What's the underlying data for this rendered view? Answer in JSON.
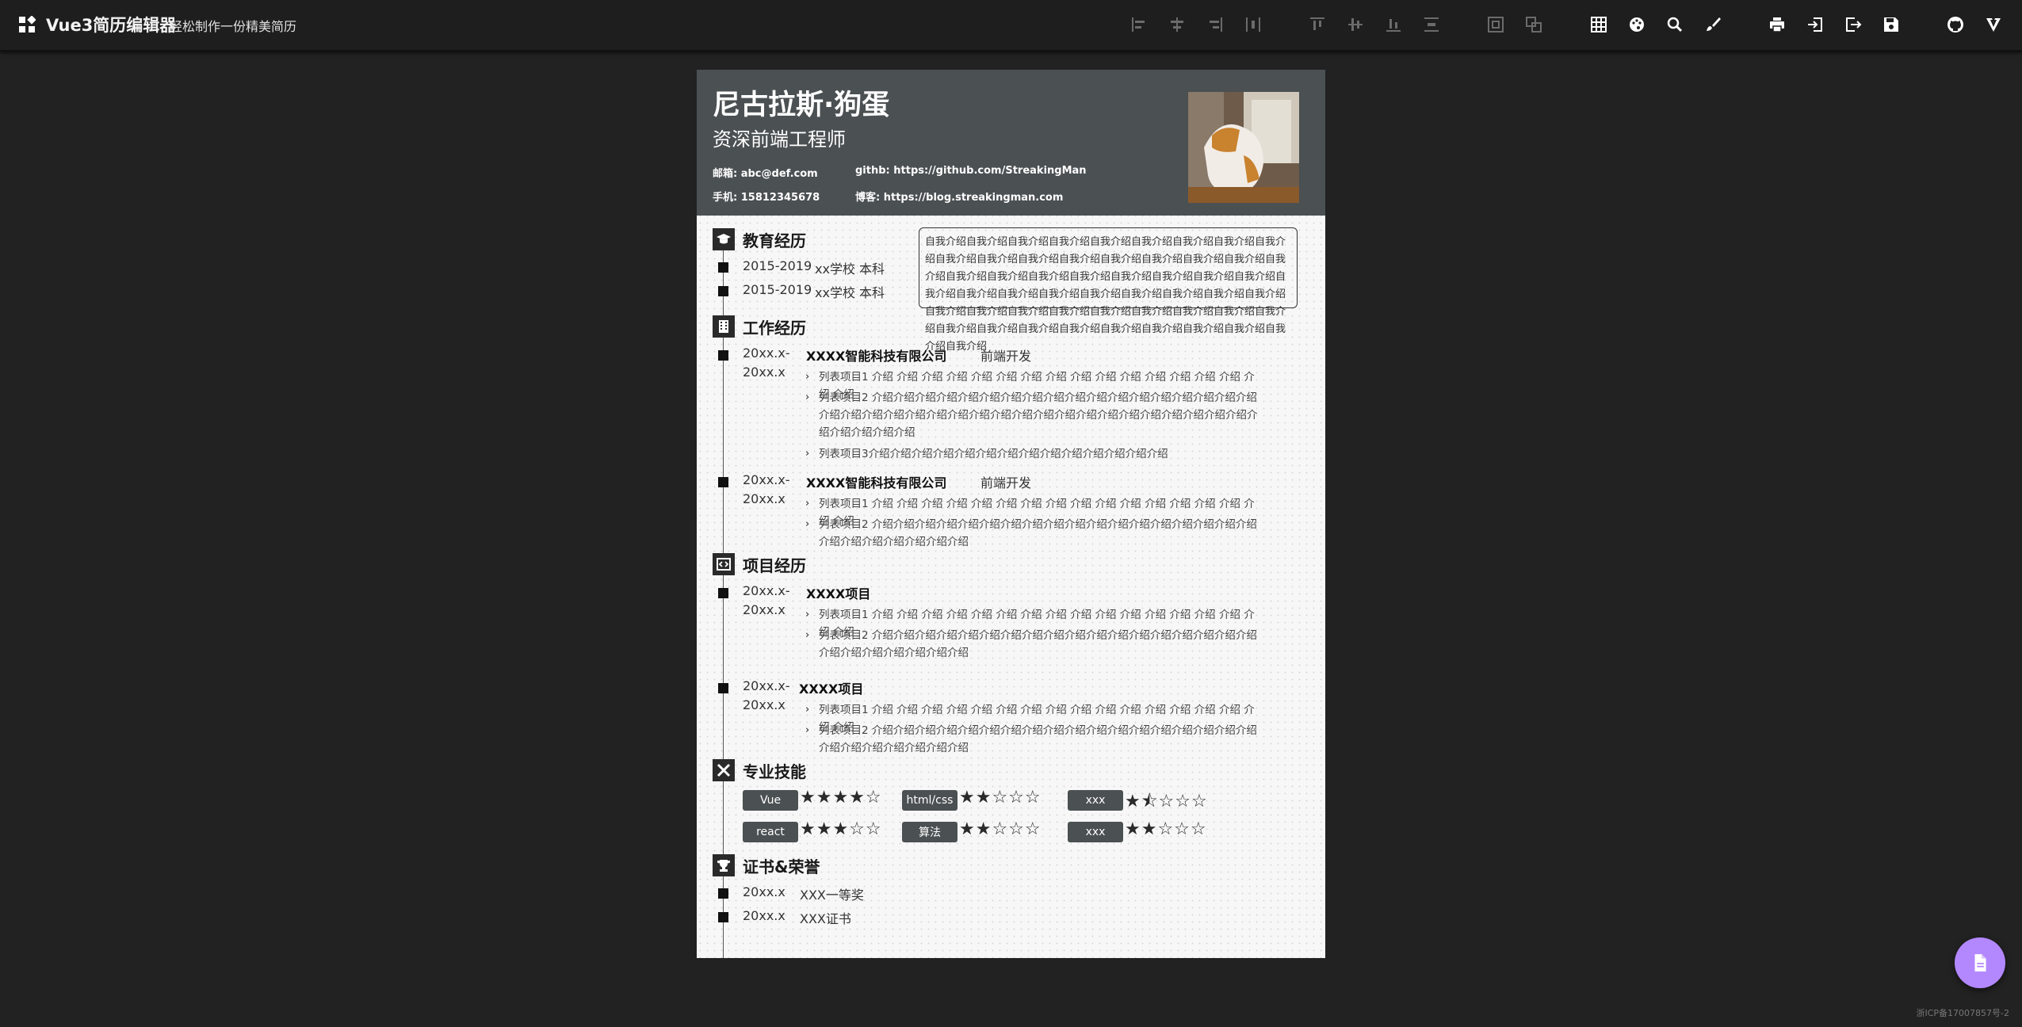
{
  "app": {
    "title": "Vue3简历编辑器",
    "subtitle": "轻松制作一份精美简历",
    "footer": "浙ICP备17007857号-2"
  },
  "toolbar": {
    "align_tools": [
      "align-left-icon",
      "align-center-horizontal-icon",
      "align-right-icon",
      "distribute-horizontal-icon",
      "align-top-icon",
      "align-middle-vertical-icon",
      "align-bottom-icon",
      "distribute-vertical-icon",
      "group-icon",
      "ungroup-icon"
    ],
    "actions": [
      "grid-icon",
      "palette-icon",
      "zoom-icon",
      "brush-icon",
      "print-icon",
      "import-icon",
      "export-icon",
      "save-icon",
      "github-icon",
      "vuetify-icon"
    ]
  },
  "resume": {
    "name": "尼古拉斯·狗蛋",
    "job": "资深前端工程师",
    "email": "邮箱: abc@def.com",
    "github": "githb: https://github.com/StreakingMan",
    "phone": "手机: 15812345678",
    "blog": "博客: https://blog.streakingman.com",
    "intro": "自我介绍自我介绍自我介绍自我介绍自我介绍自我介绍自我介绍自我介绍自我介绍自我介绍自我介绍自我介绍自我介绍自我介绍自我介绍自我介绍自我介绍自我介绍自我介绍自我介绍自我介绍自我介绍自我介绍自我介绍自我介绍自我介绍自我介绍自我介绍自我介绍自我介绍自我介绍自我介绍自我介绍自我介绍自我介绍自我介绍自我介绍自我介绍自我介绍自我介绍自我介绍自我介绍自我介绍自我介绍自我介绍自我介绍自我介绍自我介绍自我介绍自我介绍自我介绍自我介绍自我介绍自我介绍",
    "education": {
      "title": "教育经历",
      "items": [
        {
          "period": "2015-2019",
          "school": "xx学校 本科"
        },
        {
          "period": "2015-2019",
          "school": "xx学校 本科"
        }
      ]
    },
    "work": {
      "title": "工作经历",
      "items": [
        {
          "period_start": "20xx.x-",
          "period_end": "20xx.x",
          "company": "XXXX智能科技有限公司",
          "role": "前端开发",
          "points": [
            "列表项目1 介绍 介绍 介绍 介绍 介绍 介绍 介绍 介绍 介绍 介绍 介绍 介绍 介绍 介绍 介绍 介绍 介绍",
            "列表项目2 介绍介绍介绍介绍介绍介绍介绍介绍介绍介绍介绍介绍介绍介绍介绍介绍介绍介绍介绍介绍介绍介绍介绍介绍介绍介绍介绍介绍介绍介绍介绍介绍介绍介绍介绍介绍介绍介绍介绍介绍介绍介绍介绍",
            "列表项目3介绍介绍介绍介绍介绍介绍介绍介绍介绍介绍介绍介绍介绍介绍"
          ]
        },
        {
          "period_start": "20xx.x-",
          "period_end": "20xx.x",
          "company": "XXXX智能科技有限公司",
          "role": "前端开发",
          "points": [
            "列表项目1 介绍 介绍 介绍 介绍 介绍 介绍 介绍 介绍 介绍 介绍 介绍 介绍 介绍 介绍 介绍 介绍 介绍",
            "列表项目2 介绍介绍介绍介绍介绍介绍介绍介绍介绍介绍介绍介绍介绍介绍介绍介绍介绍介绍介绍介绍介绍介绍介绍介绍介绍"
          ]
        }
      ]
    },
    "projects": {
      "title": "项目经历",
      "items": [
        {
          "period_start": "20xx.x-",
          "period_end": "20xx.x",
          "name": "XXXX项目",
          "points": [
            "列表项目1 介绍 介绍 介绍 介绍 介绍 介绍 介绍 介绍 介绍 介绍 介绍 介绍 介绍 介绍 介绍 介绍 介绍",
            "列表项目2 介绍介绍介绍介绍介绍介绍介绍介绍介绍介绍介绍介绍介绍介绍介绍介绍介绍介绍介绍介绍介绍介绍介绍介绍介绍"
          ]
        },
        {
          "period_start": "20xx.x-",
          "period_end": "20xx.x",
          "name": "XXXX项目",
          "points": [
            "列表项目1 介绍 介绍 介绍 介绍 介绍 介绍 介绍 介绍 介绍 介绍 介绍 介绍 介绍 介绍 介绍 介绍 介绍",
            "列表项目2 介绍介绍介绍介绍介绍介绍介绍介绍介绍介绍介绍介绍介绍介绍介绍介绍介绍介绍介绍介绍介绍介绍介绍介绍介绍"
          ]
        }
      ]
    },
    "skills": {
      "title": "专业技能",
      "items": [
        {
          "name": "Vue",
          "rating": "4/5",
          "stars": "★★★★☆"
        },
        {
          "name": "html/css",
          "rating": "2/5",
          "stars": "★★☆☆☆"
        },
        {
          "name": "xxx",
          "rating": "1.5/5",
          "stars": "★⯪☆☆☆"
        },
        {
          "name": "react",
          "rating": "3/5",
          "stars": "★★★☆☆"
        },
        {
          "name": "算法",
          "rating": "2/5",
          "stars": "★★☆☆☆"
        },
        {
          "name": "xxx",
          "rating": "2/5",
          "stars": "★★☆☆☆"
        }
      ]
    },
    "awards": {
      "title": "证书&荣誉",
      "items": [
        {
          "date": "20xx.x",
          "name": "XXX一等奖"
        },
        {
          "date": "20xx.x",
          "name": "XXX证书"
        }
      ]
    }
  },
  "colors": {
    "background": "#222222",
    "toolbar": "#1e1e1e",
    "resume_header": "#4b5052",
    "fab": "#b388ff"
  }
}
